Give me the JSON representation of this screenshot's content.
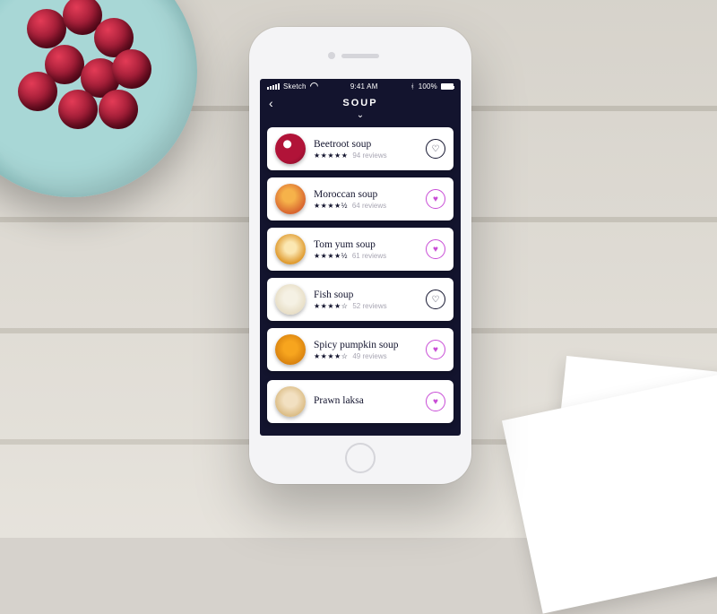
{
  "status": {
    "carrier": "Sketch",
    "time": "9:41 AM",
    "bt_pct": "100%"
  },
  "header": {
    "title": "SOUP"
  },
  "items": [
    {
      "name": "Beetroot soup",
      "reviews": "94 reviews",
      "stars": "★★★★★",
      "fav": false
    },
    {
      "name": "Moroccan soup",
      "reviews": "64 reviews",
      "stars": "★★★★½",
      "fav": true
    },
    {
      "name": "Tom yum soup",
      "reviews": "61 reviews",
      "stars": "★★★★½",
      "fav": true
    },
    {
      "name": "Fish soup",
      "reviews": "52 reviews",
      "stars": "★★★★☆",
      "fav": false
    },
    {
      "name": "Spicy pumpkin soup",
      "reviews": "49 reviews",
      "stars": "★★★★☆",
      "fav": true
    },
    {
      "name": "Prawn laksa",
      "reviews": "",
      "stars": "",
      "fav": true
    }
  ]
}
